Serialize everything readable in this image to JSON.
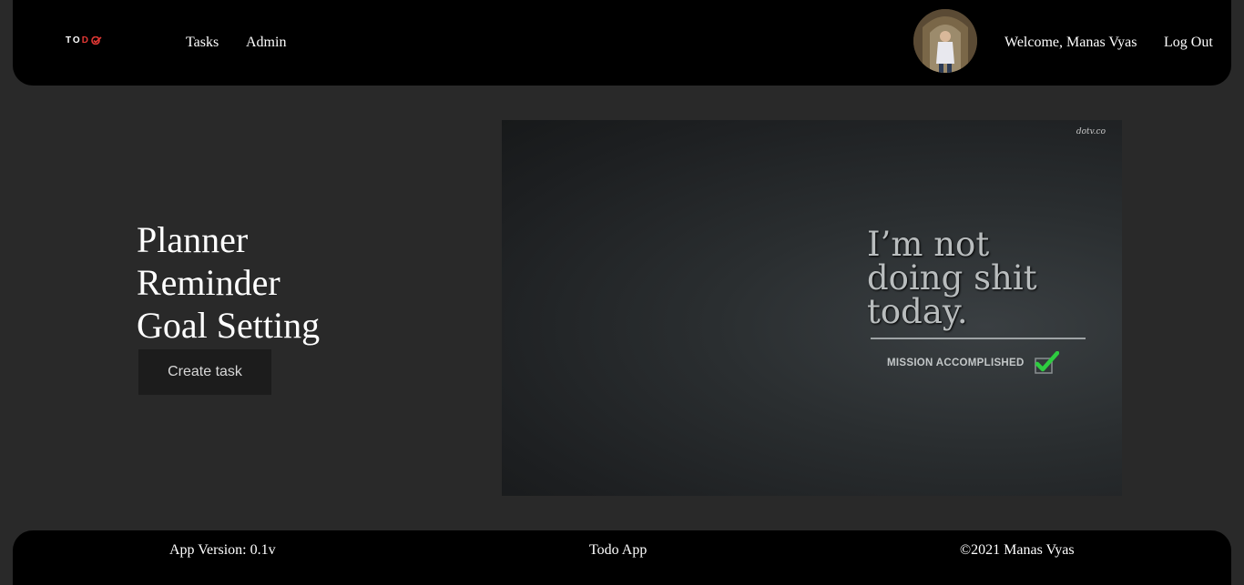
{
  "nav": {
    "logo_main": "TO",
    "logo_accent": "D",
    "links": [
      "Tasks",
      "Admin"
    ],
    "welcome": "Welcome, Manas Vyas",
    "logout": "Log Out"
  },
  "hero": {
    "lines": [
      "Planner",
      "Reminder",
      "Goal Setting"
    ],
    "create_button": "Create task"
  },
  "image": {
    "watermark": "dotv.co",
    "quote_lines": [
      "I’m not",
      "doing shit",
      "today."
    ],
    "caption": "MISSION ACCOMPLISHED"
  },
  "footer": {
    "version": "App Version: 0.1v",
    "app_name": "Todo App",
    "copyright": "©2021 Manas Vyas"
  },
  "colors": {
    "nav_bg": "#000000",
    "page_bg": "#292929",
    "logo_accent": "#e53935",
    "check_green": "#2ecc40"
  }
}
